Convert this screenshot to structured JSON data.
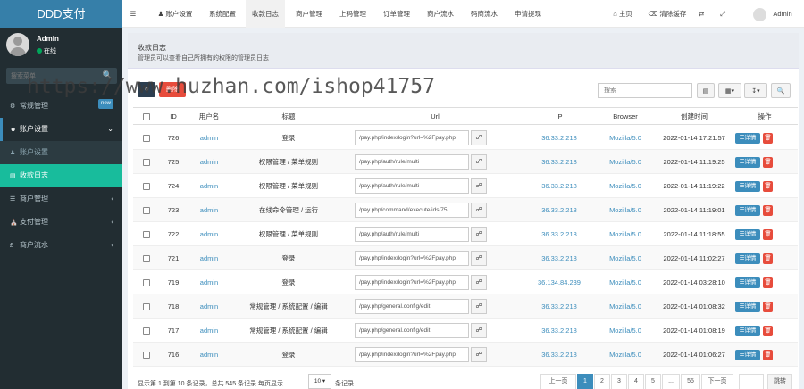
{
  "brand": "DDD支付",
  "user": {
    "name": "Admin",
    "status": "在线"
  },
  "sidebar": {
    "search_placeholder": "搜索菜单",
    "items": [
      {
        "label": "常规管理",
        "badge": "new"
      },
      {
        "label": "账户设置"
      },
      {
        "label": "账户设置"
      },
      {
        "label": "收款日志"
      },
      {
        "label": "商户管理"
      },
      {
        "label": "支付管理"
      },
      {
        "label": "商户流水"
      }
    ]
  },
  "topnav": {
    "tabs": [
      "账户设置",
      "系统配置",
      "收款日志",
      "商户管理",
      "上码管理",
      "订单管理",
      "商户流水",
      "码商流水",
      "申请提现"
    ],
    "home": "主页",
    "clear_cache": "清除缓存",
    "user": "Admin"
  },
  "panel": {
    "title": "收款日志",
    "description": "管理员可以查看自己所拥有的权限的管理员日志"
  },
  "toolbar": {
    "search_placeholder": "搜索",
    "delete_label": "删除"
  },
  "table": {
    "headers": [
      "ID",
      "用户名",
      "标题",
      "Url",
      "IP",
      "Browser",
      "创建时间",
      "操作"
    ],
    "edit_label": "详情",
    "rows": [
      {
        "id": "726",
        "user": "admin",
        "title": "登录",
        "url": "/pay.php/index/login?url=%2Fpay.php",
        "ip": "36.33.2.218",
        "browser": "Mozilla/5.0",
        "time": "2022-01-14 17:21:57"
      },
      {
        "id": "725",
        "user": "admin",
        "title": "权限管理 / 菜单规则",
        "url": "/pay.php/auth/rule/multi",
        "ip": "36.33.2.218",
        "browser": "Mozilla/5.0",
        "time": "2022-01-14 11:19:25"
      },
      {
        "id": "724",
        "user": "admin",
        "title": "权限管理 / 菜单规则",
        "url": "/pay.php/auth/rule/multi",
        "ip": "36.33.2.218",
        "browser": "Mozilla/5.0",
        "time": "2022-01-14 11:19:22"
      },
      {
        "id": "723",
        "user": "admin",
        "title": "在线命令管理 / 运行",
        "url": "/pay.php/command/execute/ids/75",
        "ip": "36.33.2.218",
        "browser": "Mozilla/5.0",
        "time": "2022-01-14 11:19:01"
      },
      {
        "id": "722",
        "user": "admin",
        "title": "权限管理 / 菜单规则",
        "url": "/pay.php/auth/rule/multi",
        "ip": "36.33.2.218",
        "browser": "Mozilla/5.0",
        "time": "2022-01-14 11:18:55"
      },
      {
        "id": "721",
        "user": "admin",
        "title": "登录",
        "url": "/pay.php/index/login?url=%2Fpay.php",
        "ip": "36.33.2.218",
        "browser": "Mozilla/5.0",
        "time": "2022-01-14 11:02:27"
      },
      {
        "id": "719",
        "user": "admin",
        "title": "登录",
        "url": "/pay.php/index/login?url=%2Fpay.php",
        "ip": "36.134.84.239",
        "browser": "Mozilla/5.0",
        "time": "2022-01-14 03:28:10"
      },
      {
        "id": "718",
        "user": "admin",
        "title": "常规管理 / 系统配置 / 编辑",
        "url": "/pay.php/general.config/edit",
        "ip": "36.33.2.218",
        "browser": "Mozilla/5.0",
        "time": "2022-01-14 01:08:32"
      },
      {
        "id": "717",
        "user": "admin",
        "title": "常规管理 / 系统配置 / 编辑",
        "url": "/pay.php/general.config/edit",
        "ip": "36.33.2.218",
        "browser": "Mozilla/5.0",
        "time": "2022-01-14 01:08:19"
      },
      {
        "id": "716",
        "user": "admin",
        "title": "登录",
        "url": "/pay.php/index/login?url=%2Fpay.php",
        "ip": "36.33.2.218",
        "browser": "Mozilla/5.0",
        "time": "2022-01-14 01:06:27"
      }
    ]
  },
  "footer": {
    "info": "显示第 1 到第 10 条记录，总共 545 条记录 每页显示",
    "page_size": "10",
    "suffix": "条记录",
    "prev": "上一页",
    "pages": [
      "1",
      "2",
      "3",
      "4",
      "5",
      "...",
      "55"
    ],
    "next": "下一页",
    "jump": "跳转"
  },
  "watermark": "https://www.huzhan.com/ishop41757"
}
